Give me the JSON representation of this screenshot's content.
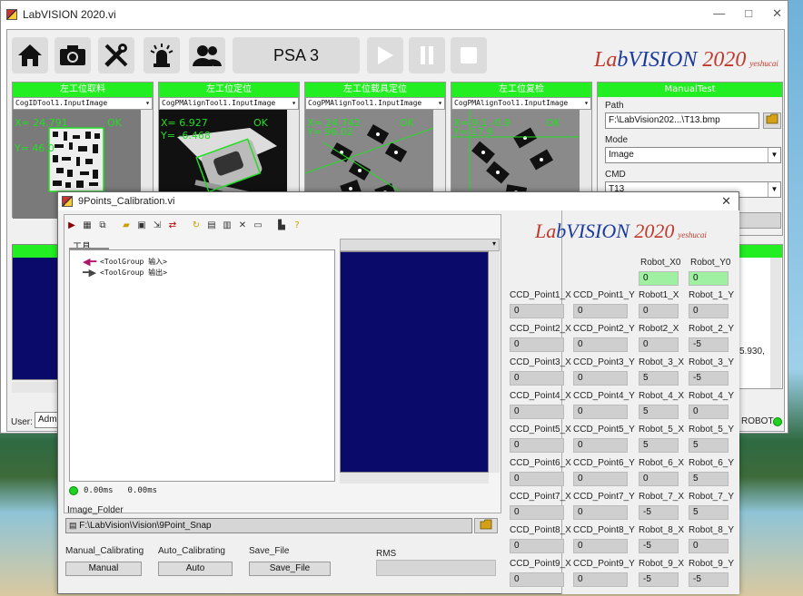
{
  "main_window": {
    "title": "LabVISION 2020.vi",
    "controls": {
      "minimize": "—",
      "maximize": "□",
      "close": "✕"
    },
    "toolbar": {
      "home_icon": "home-icon",
      "camera_icon": "camera-icon",
      "tools_icon": "tools-icon",
      "alarm_icon": "alarm-icon",
      "users_icon": "users-icon",
      "recipe_label": "PSA 3"
    },
    "logo": {
      "la": "La",
      "b": "b",
      "vision": "VISION",
      "year": "2020",
      "author": "yeshucai"
    },
    "cameras": [
      {
        "header": "左工位取料",
        "tool": "CogIDTool1.InputImage",
        "ov1": "X= 24.791",
        "ov2": "Y= 46.0",
        "ok": "OK"
      },
      {
        "header": "左工位定位",
        "tool": "CogPMAlignTool1.InputImage",
        "ov1": "X= 6.927",
        "ov2": "Y= -6.468",
        "ok": "OK"
      },
      {
        "header": "左工位载具定位",
        "tool": "CogPMAlignTool1.InputImage",
        "ov1": "X= 24.742",
        "ov2": "Y= 96.02",
        "ok": "OK"
      },
      {
        "header": "左工位复检",
        "tool": "CogPMAlignTool1.InputImage",
        "ov1": "X= 9.1 -0.9",
        "ov2": "Y= 17.9",
        "ok": "OK"
      }
    ],
    "manual_test": {
      "header": "ManualTest",
      "path_label": "Path",
      "path_value": "F:\\LabVision202...\\T13.bmp",
      "mode_label": "Mode",
      "mode_value": "Image",
      "cmd_label": "CMD",
      "cmd_value": "T13"
    },
    "log_fragment": "5.930,",
    "user_label": "User:",
    "user_value": "Admi",
    "robot_label": "ROBOT"
  },
  "dialog": {
    "title": "9Points_Calibration.vi",
    "close": "✕",
    "tab_label": "工具",
    "tree_items": [
      "<ToolGroup 输入>",
      "<ToolGroup 输出>"
    ],
    "status_time1": "0.00ms",
    "status_time2": "0.00ms",
    "image_folder_label": "Image_Folder",
    "image_folder_value": "F:\\LabVision\\Vision\\9Point_Snap",
    "manual_cal_label": "Manual_Calibrating",
    "auto_cal_label": "Auto_Calibrating",
    "save_file_label": "Save_File",
    "rms_label": "RMS",
    "manual_button": "Manual",
    "auto_button": "Auto",
    "save_button": "Save_File",
    "logo": {
      "la": "La",
      "b": "b",
      "vision": "VISION",
      "year": "2020",
      "author": "yeshucai"
    },
    "robot_origin": {
      "x_label": "Robot_X0",
      "y_label": "Robot_Y0",
      "x_value": "0",
      "y_value": "0"
    },
    "points": [
      {
        "ccd_x_label": "CCD_Point1_X",
        "ccd_y_label": "CCD_Point1_Y",
        "rob_x_label": "Robot1_X",
        "rob_y_label": "Robot_1_Y",
        "ccd_x": "0",
        "ccd_y": "0",
        "rob_x": "0",
        "rob_y": "0"
      },
      {
        "ccd_x_label": "CCD_Point2_X",
        "ccd_y_label": "CCD_Point2_Y",
        "rob_x_label": "Robot2_X",
        "rob_y_label": "Robot_2_Y",
        "ccd_x": "0",
        "ccd_y": "0",
        "rob_x": "0",
        "rob_y": "-5"
      },
      {
        "ccd_x_label": "CCD_Point3_X",
        "ccd_y_label": "CCD_Point3_Y",
        "rob_x_label": "Robot_3_X",
        "rob_y_label": "Robot_3_Y",
        "ccd_x": "0",
        "ccd_y": "0",
        "rob_x": "5",
        "rob_y": "-5"
      },
      {
        "ccd_x_label": "CCD_Point4_X",
        "ccd_y_label": "CCD_Point4_Y",
        "rob_x_label": "Robot_4_X",
        "rob_y_label": "Robot_4_Y",
        "ccd_x": "0",
        "ccd_y": "0",
        "rob_x": "5",
        "rob_y": "0"
      },
      {
        "ccd_x_label": "CCD_Point5_X",
        "ccd_y_label": "CCD_Point5_Y",
        "rob_x_label": "Robot_5_X",
        "rob_y_label": "Robot_5_Y",
        "ccd_x": "0",
        "ccd_y": "0",
        "rob_x": "5",
        "rob_y": "5"
      },
      {
        "ccd_x_label": "CCD_Point6_X",
        "ccd_y_label": "CCD_Point6_Y",
        "rob_x_label": "Robot_6_X",
        "rob_y_label": "Robot_6_Y",
        "ccd_x": "0",
        "ccd_y": "0",
        "rob_x": "0",
        "rob_y": "5"
      },
      {
        "ccd_x_label": "CCD_Point7_X",
        "ccd_y_label": "CCD_Point7_Y",
        "rob_x_label": "Robot_7_X",
        "rob_y_label": "Robot_7_Y",
        "ccd_x": "0",
        "ccd_y": "0",
        "rob_x": "-5",
        "rob_y": "5"
      },
      {
        "ccd_x_label": "CCD_Point8_X",
        "ccd_y_label": "CCD_Point8_Y",
        "rob_x_label": "Robot_8_X",
        "rob_y_label": "Robot_8_Y",
        "ccd_x": "0",
        "ccd_y": "0",
        "rob_x": "-5",
        "rob_y": "0"
      },
      {
        "ccd_x_label": "CCD_Point9_X",
        "ccd_y_label": "CCD_Point9_Y",
        "rob_x_label": "Robot_9_X",
        "rob_y_label": "Robot_9_Y",
        "ccd_x": "0",
        "ccd_y": "0",
        "rob_x": "-5",
        "rob_y": "-5"
      }
    ]
  },
  "colors": {
    "header_green": "#22ee22",
    "dark_image": "#0a0a6a",
    "logo_red": "#c0392b",
    "logo_blue": "#1a3a9c",
    "origin_green": "#9ff0a0"
  }
}
